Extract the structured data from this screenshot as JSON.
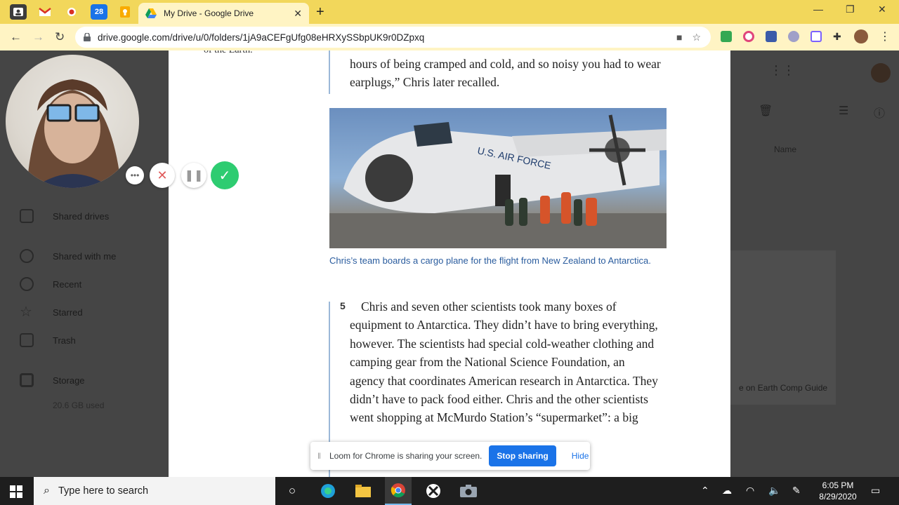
{
  "browser": {
    "active_tab_title": "My Drive - Google Drive",
    "url": "drive.google.com/drive/u/0/folders/1jA9aCEFgUfg08eHRXySSbpUK9r0DZpxq",
    "calendar_favicon_text": "28"
  },
  "drive": {
    "nav": {
      "shared_drives": "Shared drives",
      "shared_with_me": "Shared with me",
      "recent": "Recent",
      "starred": "Starred",
      "trash": "Trash",
      "storage": "Storage",
      "storage_used": "20.6 GB used"
    },
    "sort_label": "Name",
    "file_label": "e on Earth Comp Guide"
  },
  "doc": {
    "sidenote": "of the Earth.",
    "quote": "hours of being cramped and cold, and so noisy you had to wear earplugs,”  Chris later recalled.",
    "caption": "Chris’s team boards a cargo plane for the flight from New Zealand to Antarctica.",
    "paragraph_number": "5",
    "paragraph": "Chris and seven other scientists took many boxes of equipment to Antarctica. They didn’t have to bring everything, however. The scientists had special cold-weather clothing and camping gear from the National Science Foundation, an agency that coordinates American research in Antarctica. They didn’t have to pack food either. Chris and the other scientists went shopping at McMurdo Station’s “supermarket”: a big",
    "plane_marking": "U.S. AIR FORCE"
  },
  "sharing_bar": {
    "message": "Loom for Chrome is sharing your screen.",
    "stop_label": "Stop sharing",
    "hide_label": "Hide"
  },
  "taskbar": {
    "search_placeholder": "Type here to search",
    "time": "6:05 PM",
    "date": "8/29/2020"
  },
  "colors": {
    "tab_strip": "#f2d75b",
    "toolbar": "#fff4c4",
    "caption_blue": "#2a5c9e",
    "stop_button": "#1a73e8",
    "loom_confirm": "#2ecc71",
    "loom_cancel": "#e05a5a"
  }
}
